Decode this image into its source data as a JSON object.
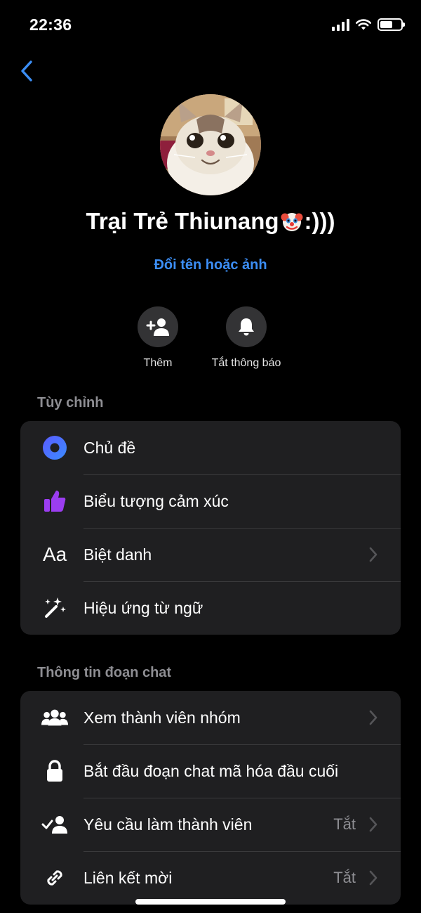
{
  "status_bar": {
    "time": "22:36",
    "battery_level": 0.62
  },
  "group": {
    "name": "Trại Trẻ Thiunang",
    "name_suffix": ":)))",
    "name_emoji": "clown-face-emoji",
    "rename_label": "Đổi tên hoặc ảnh"
  },
  "actions": {
    "add_label": "Thêm",
    "mute_label": "Tắt thông báo"
  },
  "customize": {
    "title": "Tùy chỉnh",
    "items": [
      {
        "label": "Chủ đề",
        "icon": "theme-icon"
      },
      {
        "label": "Biểu tượng cảm xúc",
        "icon": "thumbs-up-icon"
      },
      {
        "label": "Biệt danh",
        "icon": "nickname-icon",
        "icon_text": "Aa"
      },
      {
        "label": "Hiệu ứng từ ngữ",
        "icon": "word-effects-icon"
      }
    ]
  },
  "chat_info": {
    "title": "Thông tin đoạn chat",
    "items": [
      {
        "label": "Xem thành viên nhóm",
        "icon": "group-members-icon"
      },
      {
        "label": "Bắt đầu đoạn chat mã hóa đầu cuối",
        "icon": "lock-icon"
      },
      {
        "label": "Yêu cầu làm thành viên",
        "icon": "member-request-icon",
        "value": "Tắt"
      },
      {
        "label": "Liên kết mời",
        "icon": "link-icon",
        "value": "Tắt"
      }
    ]
  },
  "colors": {
    "accent": "#3c8ef5",
    "background": "#000000",
    "card": "#1f1f21",
    "emoji_purple": "#8a2be2"
  }
}
